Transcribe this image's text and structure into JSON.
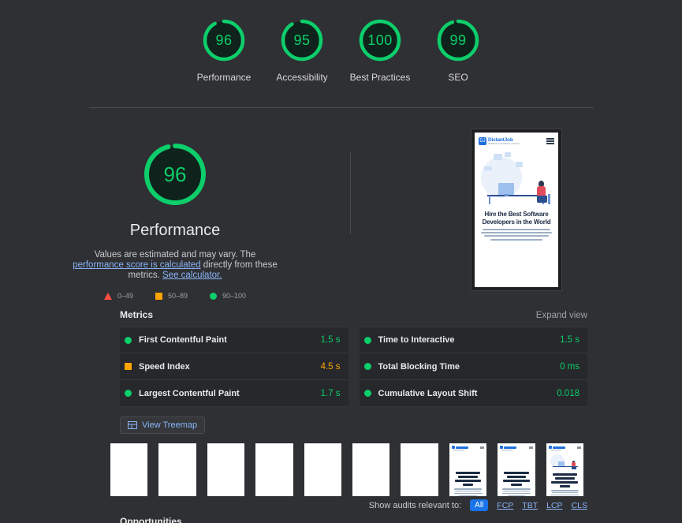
{
  "categories": [
    {
      "label": "Performance",
      "score": 96,
      "color": "#0cce6b"
    },
    {
      "label": "Accessibility",
      "score": 95,
      "color": "#0cce6b"
    },
    {
      "label": "Best Practices",
      "score": 100,
      "color": "#0cce6b"
    },
    {
      "label": "SEO",
      "score": 99,
      "color": "#0cce6b"
    }
  ],
  "performance": {
    "score": 96,
    "title": "Performance",
    "description_pre": "Values are estimated and may vary. The ",
    "link1": "performance score is calculated",
    "description_mid": " directly from these metrics. ",
    "link2": "See calculator.",
    "legend": [
      {
        "shape": "triangle",
        "range": "0–49",
        "color": "#ff4e42"
      },
      {
        "shape": "square",
        "range": "50–89",
        "color": "#ffa400"
      },
      {
        "shape": "circle",
        "range": "90–100",
        "color": "#0cce6b"
      }
    ]
  },
  "screenshot": {
    "brand": "DistantJob",
    "brand_mark": "DJ",
    "brand_sub": "REMOTE PLACEMENT AGENCY",
    "headline": "Hire the Best Software Developers in the World",
    "menu_icon": "hamburger-icon"
  },
  "metrics": {
    "title": "Metrics",
    "expand_label": "Expand view",
    "left": [
      {
        "name": "First Contentful Paint",
        "value": "1.5 s",
        "rating": "pass",
        "color": "#0cce6b",
        "shape": "circle"
      },
      {
        "name": "Speed Index",
        "value": "4.5 s",
        "rating": "average",
        "color": "#ffa400",
        "shape": "square"
      },
      {
        "name": "Largest Contentful Paint",
        "value": "1.7 s",
        "rating": "pass",
        "color": "#0cce6b",
        "shape": "circle"
      }
    ],
    "right": [
      {
        "name": "Time to Interactive",
        "value": "1.5 s",
        "rating": "pass",
        "color": "#0cce6b",
        "shape": "circle"
      },
      {
        "name": "Total Blocking Time",
        "value": "0 ms",
        "rating": "pass",
        "color": "#0cce6b",
        "shape": "circle"
      },
      {
        "name": "Cumulative Layout Shift",
        "value": "0.018",
        "rating": "pass",
        "color": "#0cce6b",
        "shape": "circle"
      }
    ]
  },
  "treemap": {
    "label": "View Treemap",
    "icon": "treemap-icon"
  },
  "filmstrip": {
    "frames": [
      {
        "state": "blank"
      },
      {
        "state": "blank"
      },
      {
        "state": "blank"
      },
      {
        "state": "blank"
      },
      {
        "state": "blank"
      },
      {
        "state": "blank"
      },
      {
        "state": "blank"
      },
      {
        "state": "text"
      },
      {
        "state": "text"
      },
      {
        "state": "full"
      }
    ]
  },
  "audit_filter": {
    "label": "Show audits relevant to:",
    "options": [
      {
        "label": "All",
        "active": true
      },
      {
        "label": "FCP",
        "active": false
      },
      {
        "label": "TBT",
        "active": false
      },
      {
        "label": "LCP",
        "active": false
      },
      {
        "label": "CLS",
        "active": false
      }
    ]
  },
  "opportunities": {
    "title": "Opportunities"
  }
}
